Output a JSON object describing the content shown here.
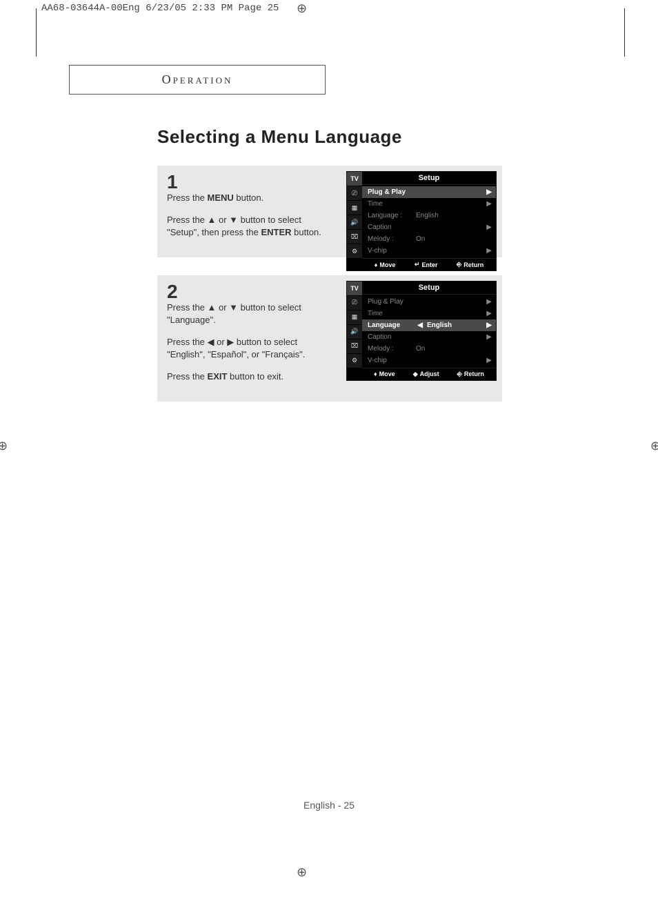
{
  "print_header": "AA68-03644A-00Eng  6/23/05  2:33 PM  Page 25",
  "section_title": "Operation",
  "main_heading": "Selecting a Menu Language",
  "step1": {
    "num": "1",
    "p1_a": "Press the ",
    "p1_b": "MENU",
    "p1_c": " button.",
    "p2_a": "Press the ▲ or ▼ button to select \"Setup\", then press the ",
    "p2_b": "ENTER",
    "p2_c": " button."
  },
  "step2": {
    "num": "2",
    "p1": "Press the ▲ or ▼ button to select \"Language\".",
    "p2": "Press the ◀ or ▶ button to select \"English\", \"Español\", or \"Français\".",
    "p3_a": "Press the ",
    "p3_b": "EXIT",
    "p3_c": " button to exit."
  },
  "menu1": {
    "title": "Setup",
    "tv_label": "TV",
    "items": [
      {
        "label": "Plug & Play",
        "value": "",
        "arrow": "▶",
        "selected": true
      },
      {
        "label": "Time",
        "value": "",
        "arrow": "▶",
        "selected": false
      },
      {
        "label": "Language :",
        "value": "English",
        "arrow": "",
        "selected": false
      },
      {
        "label": "Caption",
        "value": "",
        "arrow": "▶",
        "selected": false
      },
      {
        "label": "Melody    :",
        "value": "On",
        "arrow": "",
        "selected": false
      },
      {
        "label": "V-chip",
        "value": "",
        "arrow": "▶",
        "selected": false
      }
    ],
    "footer": {
      "a": "Move",
      "b": "Enter",
      "c": "Return"
    }
  },
  "menu2": {
    "title": "Setup",
    "tv_label": "TV",
    "items": [
      {
        "label": "Plug & Play",
        "value": "",
        "arrow": "▶",
        "selected": false
      },
      {
        "label": "Time",
        "value": "",
        "arrow": "▶",
        "selected": false
      },
      {
        "label": "Language",
        "value": "English",
        "arrow": "▶",
        "arrow_l": "◀",
        "selected": true
      },
      {
        "label": "Caption",
        "value": "",
        "arrow": "▶",
        "selected": false
      },
      {
        "label": "Melody    :",
        "value": "On",
        "arrow": "",
        "selected": false
      },
      {
        "label": "V-chip",
        "value": "",
        "arrow": "▶",
        "selected": false
      }
    ],
    "footer": {
      "a": "Move",
      "b": "Adjust",
      "c": "Return"
    }
  },
  "page_footer": "English - 25",
  "crop_mark": "⊕"
}
